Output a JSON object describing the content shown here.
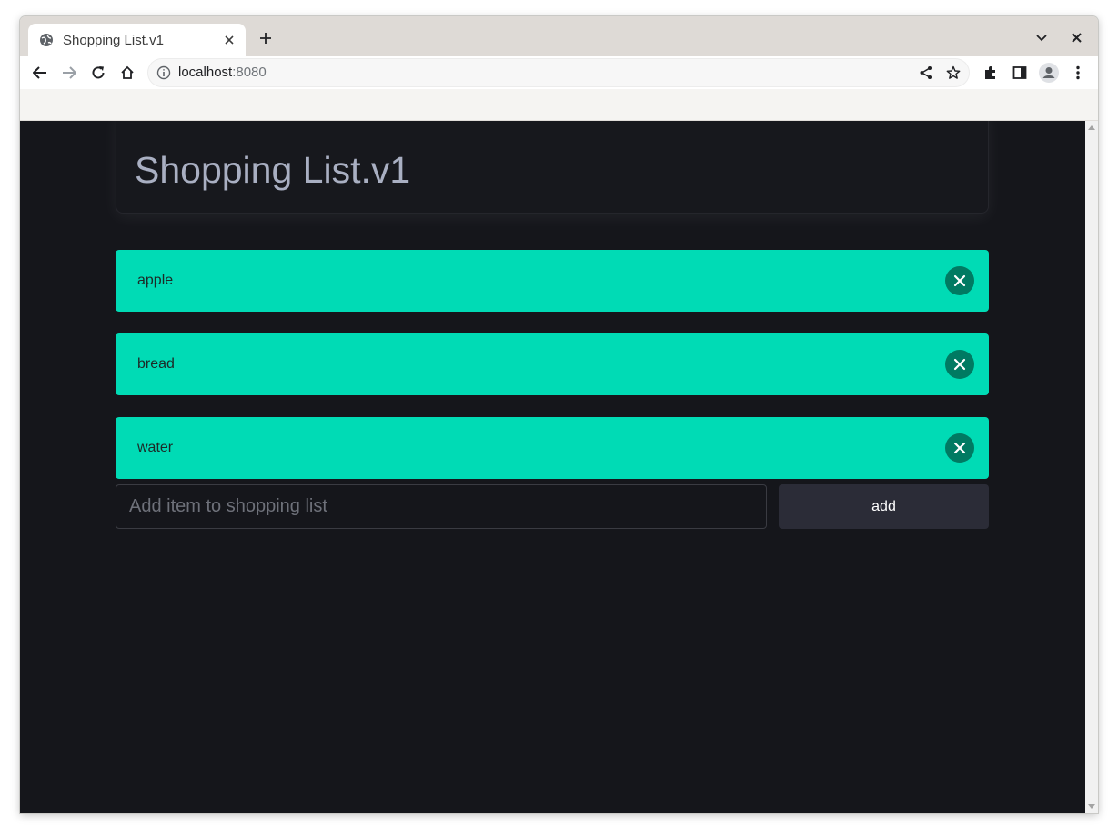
{
  "browser": {
    "tab_title": "Shopping List.v1",
    "url_host": "localhost",
    "url_port": ":8080"
  },
  "icons": {
    "favicon": "globe-icon",
    "tab_close": "close-icon",
    "new_tab": "plus-icon",
    "tab_search": "chevron-down-icon",
    "window_close": "close-icon",
    "back": "arrow-left-icon",
    "forward": "arrow-right-icon",
    "reload": "reload-icon",
    "home": "home-icon",
    "site_info": "info-icon",
    "share": "share-icon",
    "bookmark": "star-icon",
    "extensions": "puzzle-icon",
    "side_panel": "side-panel-icon",
    "profile": "avatar-icon",
    "menu": "kebab-menu-icon",
    "item_remove": "close-icon"
  },
  "app": {
    "title": "Shopping List.v1",
    "items": [
      {
        "label": "apple"
      },
      {
        "label": "bread"
      },
      {
        "label": "water"
      }
    ],
    "input_placeholder": "Add item to shopping list",
    "add_label": "add"
  },
  "colors": {
    "page_bg": "#15161b",
    "item_bg": "#00dbb5",
    "remove_bg": "#007a62",
    "button_bg": "#2b2c37",
    "title_color": "#a9afc2"
  }
}
